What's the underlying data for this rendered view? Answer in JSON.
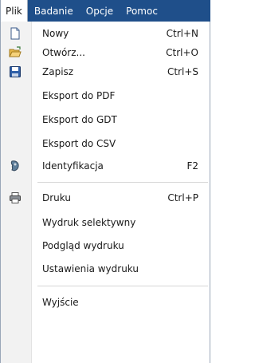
{
  "menubar": {
    "items": [
      {
        "label": "Plik"
      },
      {
        "label": "Badanie"
      },
      {
        "label": "Opcje"
      },
      {
        "label": "Pomoc"
      }
    ]
  },
  "menu": {
    "items": [
      {
        "label": "Nowy",
        "shortcut": "Ctrl+N",
        "icon": "new-document-icon"
      },
      {
        "label": "Otwórz...",
        "shortcut": "Ctrl+O",
        "icon": "open-folder-icon"
      },
      {
        "label": "Zapisz",
        "shortcut": "Ctrl+S",
        "icon": "save-disk-icon"
      },
      {
        "label": "Eksport do PDF",
        "shortcut": ""
      },
      {
        "label": "Eksport do GDT",
        "shortcut": ""
      },
      {
        "label": "Eksport do CSV",
        "shortcut": ""
      },
      {
        "label": "Identyfikacja",
        "shortcut": "F2",
        "icon": "identification-icon"
      },
      {
        "label": "Druku",
        "shortcut": "Ctrl+P",
        "icon": "printer-icon"
      },
      {
        "label": "Wydruk selektywny",
        "shortcut": ""
      },
      {
        "label": "Podgląd wydruku",
        "shortcut": ""
      },
      {
        "label": "Ustawienia wydruku",
        "shortcut": ""
      },
      {
        "label": "Wyjście",
        "shortcut": ""
      }
    ]
  },
  "colors": {
    "menubar_bg": "#1f4f8a",
    "icon_gutter": "#f2f2f2"
  }
}
